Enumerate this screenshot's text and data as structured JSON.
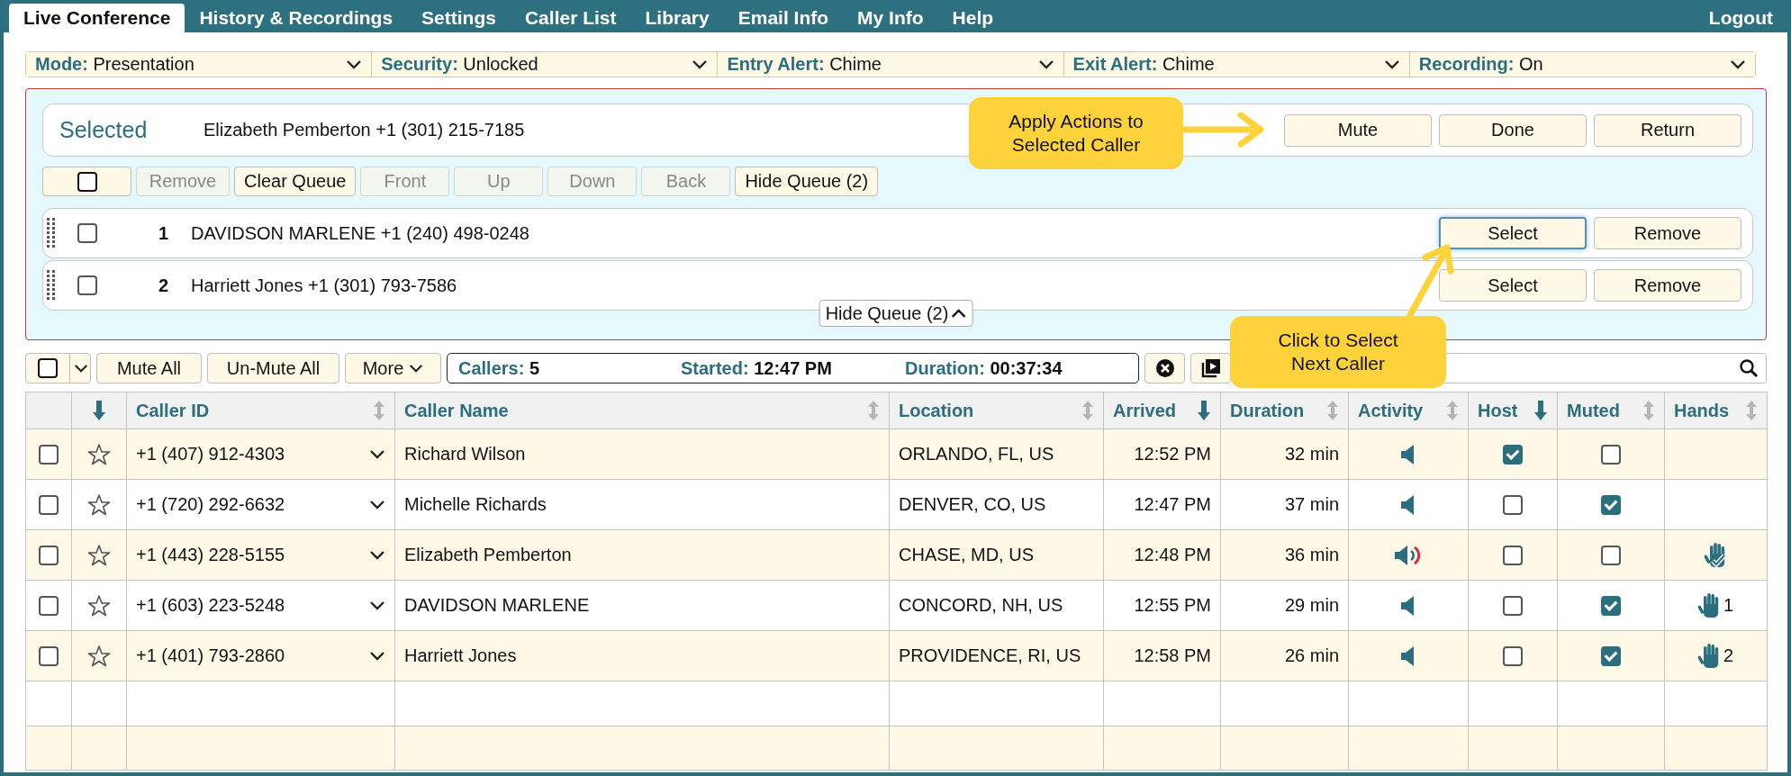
{
  "nav": {
    "tabs": [
      {
        "label": "Live Conference",
        "selected": true
      },
      {
        "label": "History & Recordings",
        "selected": false
      },
      {
        "label": "Settings",
        "selected": false
      },
      {
        "label": "Caller List",
        "selected": false
      },
      {
        "label": "Library",
        "selected": false
      },
      {
        "label": "Email Info",
        "selected": false
      },
      {
        "label": "My Info",
        "selected": false
      },
      {
        "label": "Help",
        "selected": false
      }
    ],
    "logout": "Logout"
  },
  "settings_bar": [
    {
      "label": "Mode:",
      "value": "Presentation"
    },
    {
      "label": "Security:",
      "value": "Unlocked"
    },
    {
      "label": "Entry Alert:",
      "value": "Chime"
    },
    {
      "label": "Exit Alert:",
      "value": "Chime"
    },
    {
      "label": "Recording:",
      "value": "On"
    }
  ],
  "selected_caller": {
    "heading": "Selected",
    "caller": "Elizabeth Pemberton +1 (301) 215-7185",
    "buttons": [
      "Mute",
      "Done",
      "Return"
    ]
  },
  "queue_toolbar": {
    "checked": false,
    "buttons": [
      {
        "label": "Remove",
        "disabled": true
      },
      {
        "label": "Clear Queue",
        "disabled": false
      },
      {
        "label": "Front",
        "disabled": true
      },
      {
        "label": "Up",
        "disabled": true
      },
      {
        "label": "Down",
        "disabled": true
      },
      {
        "label": "Back",
        "disabled": true
      },
      {
        "label": "Hide Queue (2)",
        "disabled": false
      }
    ]
  },
  "queue": [
    {
      "number": "1",
      "caller": "DAVIDSON MARLENE +1 (240) 498-0248",
      "checked": false,
      "select": "Select",
      "select_focused": true,
      "remove": "Remove"
    },
    {
      "number": "2",
      "caller": "Harriett Jones +1 (301) 793-7586",
      "checked": false,
      "select": "Select",
      "select_focused": false,
      "remove": "Remove"
    }
  ],
  "hide_queue_tab": "Hide Queue (2)",
  "toolbar": {
    "checked": false,
    "buttons": [
      {
        "label": "Mute All",
        "menu": false
      },
      {
        "label": "Un-Mute All",
        "menu": false
      },
      {
        "label": "More",
        "menu": true
      }
    ],
    "stats": [
      {
        "label": "Callers:",
        "value": "5"
      },
      {
        "label": "Started:",
        "value": "12:47 PM"
      },
      {
        "label": "Duration:",
        "value": "00:37:34"
      }
    ]
  },
  "table": {
    "columns": [
      {
        "sorted": true
      },
      {
        "label": "Caller ID",
        "sorted": false
      },
      {
        "label": "Caller Name",
        "sorted": false
      },
      {
        "label": "Location",
        "sorted": false
      },
      {
        "label": "Arrived",
        "sorted": true
      },
      {
        "label": "Duration",
        "sorted": false
      },
      {
        "label": "Activity",
        "sorted": false
      },
      {
        "label": "Host",
        "sorted": true
      },
      {
        "label": "Muted",
        "sorted": false
      },
      {
        "label": "Hands",
        "sorted": false
      }
    ],
    "rows": [
      {
        "checked": false,
        "starred": false,
        "caller_id": "+1 (407) 912-4303",
        "name": "Richard Wilson",
        "location": "ORLANDO, FL, US",
        "arrived": "12:52 PM",
        "duration": "32 min",
        "speaking": false,
        "host": true,
        "muted": false
      },
      {
        "checked": false,
        "starred": false,
        "caller_id": "+1 (720) 292-6632",
        "name": "Michelle Richards",
        "location": "DENVER, CO, US",
        "arrived": "12:47 PM",
        "duration": "37 min",
        "speaking": false,
        "host": false,
        "muted": true
      },
      {
        "checked": false,
        "starred": false,
        "caller_id": "+1 (443) 228-5155",
        "name": "Elizabeth Pemberton",
        "location": "CHASE, MD, US",
        "arrived": "12:48 PM",
        "duration": "36 min",
        "speaking": true,
        "host": false,
        "muted": false,
        "hand_raised": true,
        "hand_acknowledged": true
      },
      {
        "checked": false,
        "starred": false,
        "caller_id": "+1 (603) 223-5248",
        "name": "DAVIDSON MARLENE",
        "location": "CONCORD, NH, US",
        "arrived": "12:55 PM",
        "duration": "29 min",
        "speaking": false,
        "host": false,
        "muted": true,
        "hand_raised": true,
        "hand_acknowledged": false,
        "hand_order": "1"
      },
      {
        "checked": false,
        "starred": false,
        "caller_id": "+1 (401) 793-2860",
        "name": "Harriett Jones",
        "location": "PROVIDENCE, RI, US",
        "arrived": "12:58 PM",
        "duration": "26 min",
        "speaking": false,
        "host": false,
        "muted": true,
        "hand_raised": true,
        "hand_acknowledged": false,
        "hand_order": "2"
      }
    ]
  },
  "callouts": [
    {
      "text": "Apply Actions to Selected Caller"
    },
    {
      "text": "Click to Select Next Caller"
    }
  ]
}
